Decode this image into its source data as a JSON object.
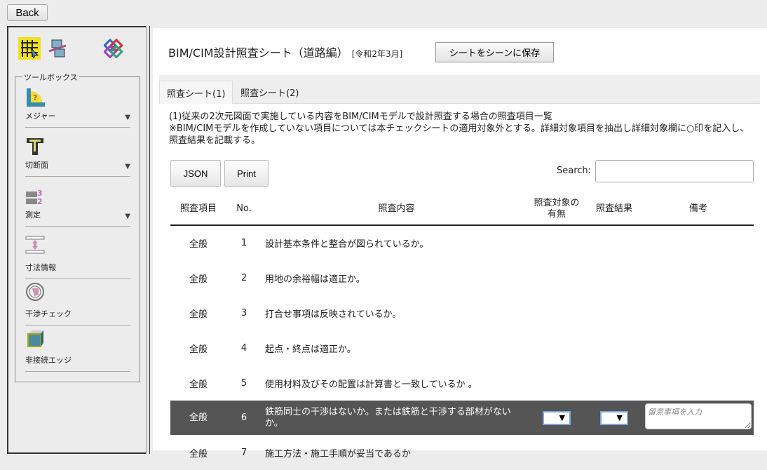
{
  "back_label": "Back",
  "toolbox": {
    "legend": "ツールボックス",
    "tools": [
      {
        "label": "メジャー",
        "dropdown": true
      },
      {
        "label": "切断面",
        "dropdown": true
      },
      {
        "label": "測定",
        "dropdown": true
      },
      {
        "label": "寸法情報"
      },
      {
        "label": "干渉チェック"
      },
      {
        "label": "非接続エッジ"
      }
    ]
  },
  "header": {
    "title": "BIM/CIM設計照査シート（道路編）",
    "subtitle": "[令和2年3月]",
    "save_label": "シートをシーンに保存"
  },
  "tabs": [
    {
      "label": "照査シート(1)",
      "active": true
    },
    {
      "label": "照査シート(2)"
    }
  ],
  "description": {
    "line1": "(1)従来の2次元図面で実施している内容をBIM/CIMモデルで設計照査する場合の照査項目一覧",
    "line2": "※BIM/CIMモデルを作成していない項目については本チェックシートの適用対象外とする。詳細対象項目を抽出し詳細対象欄に○印を記入し、照査結果を記載する。"
  },
  "buttons": {
    "json": "JSON",
    "print": "Print"
  },
  "search": {
    "label": "Search:",
    "value": ""
  },
  "table": {
    "headers": [
      "照査項目",
      "No.",
      "照査内容",
      "照査対象の有無",
      "照査結果",
      "備考"
    ],
    "rows": [
      {
        "item": "全般",
        "no": "1",
        "content": "設計基本条件と整合が図られているか。"
      },
      {
        "item": "全般",
        "no": "2",
        "content": "用地の余裕幅は適正か。"
      },
      {
        "item": "全般",
        "no": "3",
        "content": "打合せ事項は反映されているか。"
      },
      {
        "item": "全般",
        "no": "4",
        "content": "起点・終点は適正か。"
      },
      {
        "item": "全般",
        "no": "5",
        "content": "使用材料及びその配置は計算書と一致しているか 。"
      },
      {
        "item": "全般",
        "no": "6",
        "content": "鉄筋同士の干渉はないか。または鉄筋と干渉する部材がないか。",
        "selected": true,
        "remark_placeholder": "留意事項を入力"
      },
      {
        "item": "全般",
        "no": "7",
        "content": "施工方法・施工手順が妥当であるか"
      }
    ]
  }
}
